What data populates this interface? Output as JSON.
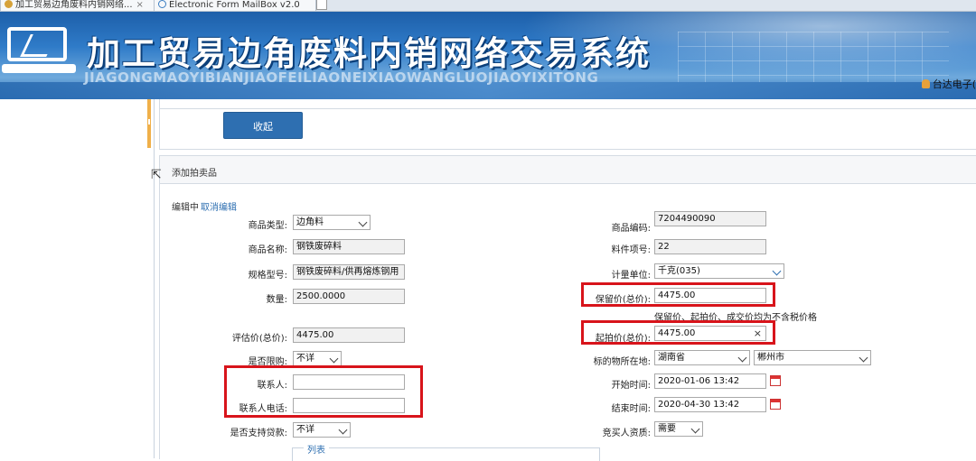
{
  "browser": {
    "tabs": [
      {
        "label": "加工贸易边角废料内销网络...",
        "close": "×"
      },
      {
        "label": "Electronic Form MailBox v2.0"
      }
    ]
  },
  "header": {
    "title": "加工贸易边角废料内销网络交易系统",
    "pinyin": "JIAGONGMAOYIBIANJIAOFEILIAONEIXIAOWANGLUOJIAOYIXITONG",
    "user": "台达电子("
  },
  "toolbar": {
    "collapse_label": "收起"
  },
  "section": {
    "title": "添加拍卖品",
    "editing_label": "编辑中",
    "cancel_edit_label": "取消编辑"
  },
  "form": {
    "left": {
      "product_type": {
        "label": "商品类型:",
        "value": "边角料"
      },
      "product_name": {
        "label": "商品名称:",
        "value": "钢铁废碎料"
      },
      "spec_model": {
        "label": "规格型号:",
        "value": "钢铁废碎料/供再熔炼钢用"
      },
      "quantity": {
        "label": "数量:",
        "value": "2500.0000"
      },
      "appraised_price": {
        "label": "评估价(总价):",
        "value": "4475.00"
      },
      "purchase_limit": {
        "label": "是否限购:",
        "value": "不详"
      },
      "contact": {
        "label": "联系人:",
        "value": ""
      },
      "contact_phone": {
        "label": "联系人电话:",
        "value": ""
      },
      "loan_support": {
        "label": "是否支持贷款:",
        "value": "不详"
      }
    },
    "right": {
      "product_code": {
        "label": "商品编码:",
        "value": "7204490090"
      },
      "item_no": {
        "label": "料件项号:",
        "value": "22"
      },
      "unit": {
        "label": "计量单位:",
        "value": "千克(035)"
      },
      "reserve_price": {
        "label": "保留价(总价):",
        "value": "4475.00"
      },
      "tax_note": "保留价、起拍价、成交价均为不含税价格",
      "starting_price": {
        "label": "起拍价(总价):",
        "value": "4475.00"
      },
      "location": {
        "label": "标的物所在地:",
        "province": "湖南省",
        "city": "郴州市"
      },
      "start_time": {
        "label": "开始时间:",
        "value": "2020-01-06 13:42"
      },
      "end_time": {
        "label": "结束时间:",
        "value": "2020-04-30 13:42"
      },
      "bidder_qualification": {
        "label": "竞买人资质:",
        "value": "需要"
      }
    },
    "list_legend": "列表"
  },
  "colors": {
    "accent": "#2e6fb1",
    "highlight": "#d8141b",
    "header": "#2f7bc8"
  }
}
